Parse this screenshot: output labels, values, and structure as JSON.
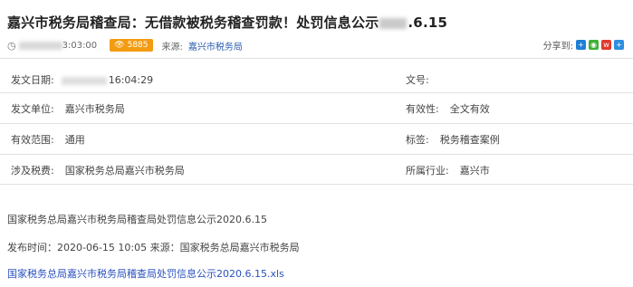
{
  "article": {
    "title_prefix": "嘉兴市税务局稽查局：无借款被税务稽查罚款！处罚信息公示",
    "title_suffix": ".6.15",
    "time_suffix": "3:03:00",
    "views": "5885",
    "source_label": "来源:",
    "source_value": "嘉兴市税务局"
  },
  "share": {
    "label": "分享到:"
  },
  "info": {
    "issue_date_label": "发文日期:",
    "issue_date_value": "16:04:29",
    "doc_no_label": "文号:",
    "issuer_label": "发文单位:",
    "issuer_value": "嘉兴市税务局",
    "validity_label": "有效性:",
    "validity_value": "全文有效",
    "scope_label": "有效范围:",
    "scope_value": "通用",
    "tags_label": "标签:",
    "tags_value": "税务稽查案例",
    "tax_label": "涉及税费:",
    "tax_value": "国家税务总局嘉兴市税务局",
    "industry_label": "所属行业:",
    "industry_value": "嘉兴市"
  },
  "content": {
    "line1": "国家税务总局嘉兴市税务局稽查局处罚信息公示2020.6.15",
    "line2": "发布时间：2020-06-15  10:05 来源：国家税务总局嘉兴市税务局",
    "attachment_link": "国家税务总局嘉兴市税务局稽查局处罚信息公示2020.6.15.xls"
  },
  "icons": {
    "clock": "clock-icon",
    "eye": "eye-icon",
    "share_icons": [
      "qzone-icon",
      "wechat-icon",
      "weibo-icon",
      "more-share-icon"
    ]
  },
  "colors": {
    "views_badge": "#f39c12",
    "link": "#2a52be",
    "divider": "#e2e2e2"
  }
}
